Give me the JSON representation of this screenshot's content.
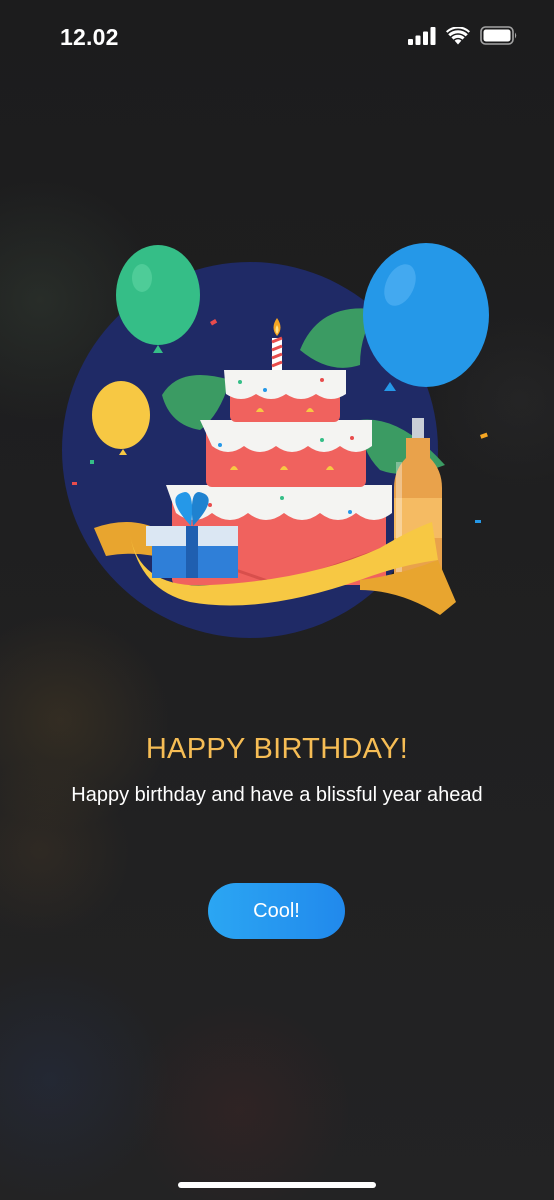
{
  "status_bar": {
    "time": "12.02",
    "icons": [
      "signal-icon",
      "wifi-icon",
      "battery-icon"
    ]
  },
  "illustration": {
    "name": "birthday-cake-illustration",
    "elements": [
      "cake",
      "candle",
      "green-balloon",
      "blue-balloon",
      "yellow-balloon",
      "gift-box",
      "bottle",
      "ribbon",
      "leaves"
    ]
  },
  "content": {
    "title": "HAPPY BIRTHDAY!",
    "subtitle": "Happy birthday and have a blissful year ahead"
  },
  "actions": {
    "confirm_label": "Cool!"
  },
  "colors": {
    "background": "#1e1e1f",
    "title": "#f6bd55",
    "button": "#2196f3",
    "circle": "#1f2a66"
  }
}
